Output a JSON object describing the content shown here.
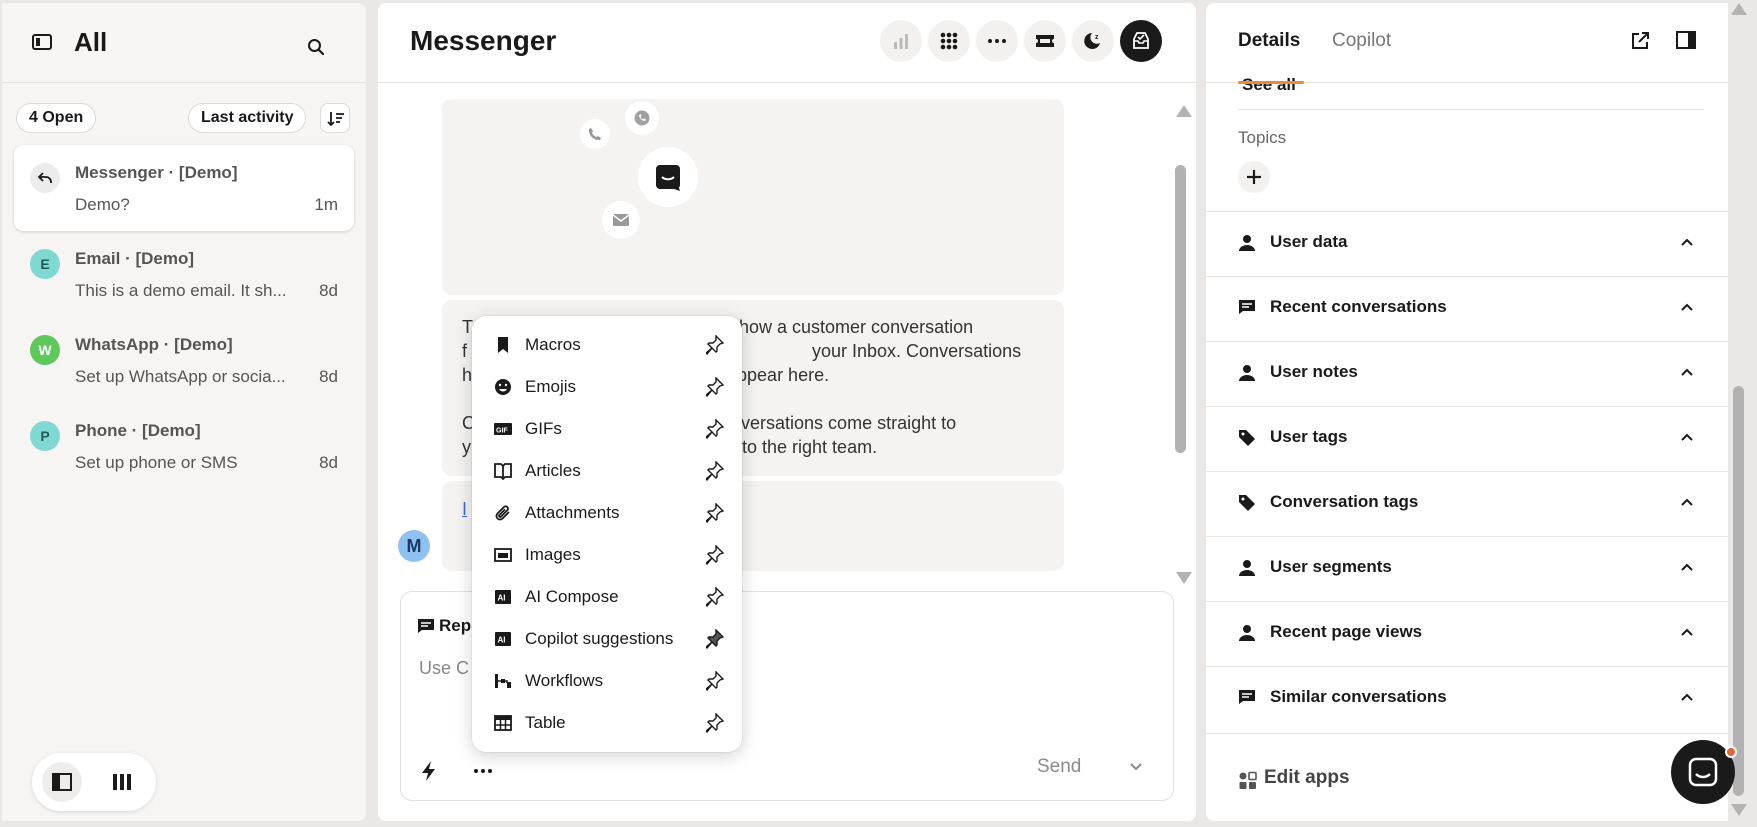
{
  "left": {
    "title": "All",
    "open_filter": "4 Open",
    "sort_label": "Last activity",
    "conversations": [
      {
        "title": "Messenger · [Demo]",
        "preview": "Demo?",
        "time": "1m",
        "avatar": "",
        "avatar_color": "#ececec",
        "active": true
      },
      {
        "title": "Email · [Demo]",
        "preview": "This is a demo email. It sh...",
        "time": "8d",
        "avatar": "E",
        "avatar_color": "#7fd8d2"
      },
      {
        "title": "WhatsApp · [Demo]",
        "preview": "Set up WhatsApp or socia...",
        "time": "8d",
        "avatar": "W",
        "avatar_color": "#5ec85a"
      },
      {
        "title": "Phone · [Demo]",
        "preview": "Set up phone or SMS",
        "time": "8d",
        "avatar": "P",
        "avatar_color": "#7fd8d2"
      }
    ]
  },
  "middle": {
    "title": "Messenger",
    "message": {
      "line1a": "T",
      "line1b": "ws how a customer conversation",
      "line2a": "f",
      "line2b": "your Inbox. Conversations",
      "line3a": "h",
      "line3b": "o appear here.",
      "line4a": "C",
      "line4b": "conversations come straight to",
      "line5a": "y",
      "line5b": "em to the right team."
    },
    "link_fragment": "I",
    "avatar_letter": "M",
    "composer": {
      "reply_label": "Rep",
      "placeholder": "Use C",
      "send_label": "Send"
    }
  },
  "menu": {
    "items": [
      {
        "label": "Macros",
        "icon": "bookmark-icon"
      },
      {
        "label": "Emojis",
        "icon": "emoji-icon"
      },
      {
        "label": "GIFs",
        "icon": "gif-icon"
      },
      {
        "label": "Articles",
        "icon": "book-icon"
      },
      {
        "label": "Attachments",
        "icon": "paperclip-icon"
      },
      {
        "label": "Images",
        "icon": "image-icon"
      },
      {
        "label": "AI Compose",
        "icon": "ai-icon"
      },
      {
        "label": "Copilot suggestions",
        "icon": "ai-icon"
      },
      {
        "label": "Workflows",
        "icon": "workflow-icon"
      },
      {
        "label": "Table",
        "icon": "table-icon"
      }
    ]
  },
  "right": {
    "tabs": [
      "Details",
      "Copilot"
    ],
    "see_all": "See all",
    "topics_label": "Topics",
    "sections": [
      {
        "label": "User data",
        "icon": "person-icon"
      },
      {
        "label": "Recent conversations",
        "icon": "chat-icon"
      },
      {
        "label": "User notes",
        "icon": "person-icon"
      },
      {
        "label": "User tags",
        "icon": "tag-icon"
      },
      {
        "label": "Conversation tags",
        "icon": "tag-icon"
      },
      {
        "label": "User segments",
        "icon": "person-icon"
      },
      {
        "label": "Recent page views",
        "icon": "person-icon"
      },
      {
        "label": "Similar conversations",
        "icon": "chat-icon"
      }
    ],
    "edit_apps": "Edit apps"
  },
  "colors": {
    "accent_orange": "#e88b3a",
    "dark": "#1a1a1a"
  }
}
